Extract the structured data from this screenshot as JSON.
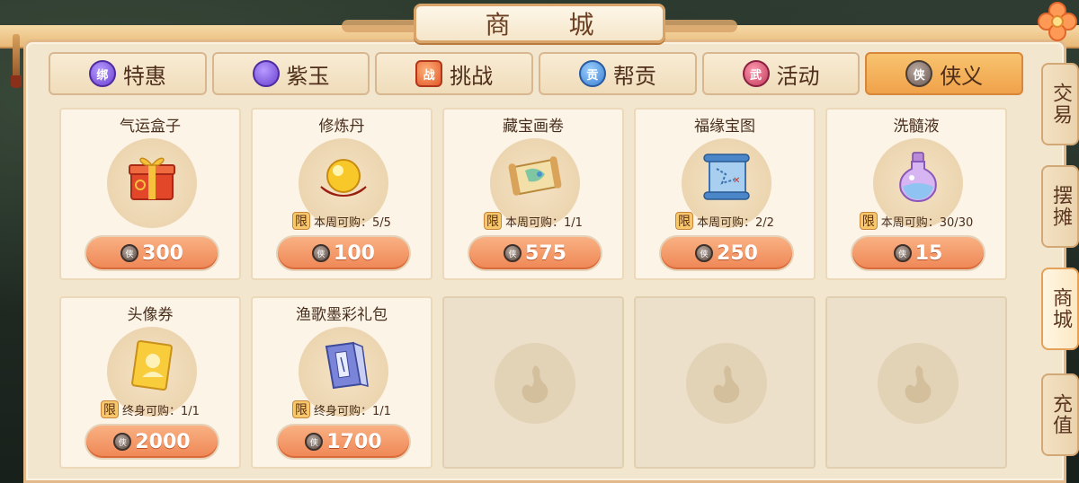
{
  "window": {
    "title": "商 城"
  },
  "tabs": [
    {
      "label": "特惠",
      "icon": "purple-orb-icon",
      "icon_text": "绑",
      "active": false
    },
    {
      "label": "紫玉",
      "icon": "purple-orb-icon",
      "icon_text": "",
      "active": false
    },
    {
      "label": "挑战",
      "icon": "challenge-badge-icon",
      "icon_text": "战",
      "active": false
    },
    {
      "label": "帮贡",
      "icon": "guild-shield-icon",
      "icon_text": "贡",
      "active": false
    },
    {
      "label": "活动",
      "icon": "event-badge-icon",
      "icon_text": "武",
      "active": false
    },
    {
      "label": "侠义",
      "icon": "chivalry-coin-icon",
      "icon_text": "侠",
      "active": true
    }
  ],
  "side_tabs": [
    {
      "label": "交易",
      "active": false
    },
    {
      "label": "摆摊",
      "active": false
    },
    {
      "label": "商城",
      "active": true
    },
    {
      "label": "充值",
      "active": false
    }
  ],
  "currency": {
    "icon": "chivalry-coin-icon",
    "glyph": "侠"
  },
  "items": [
    {
      "name": "气运盒子",
      "art": "gift-box",
      "limit_label": "",
      "limit_text": "",
      "price": "300"
    },
    {
      "name": "修炼丹",
      "art": "golden-pill",
      "limit_label": "限",
      "limit_text": "本周可购：5/5",
      "price": "100"
    },
    {
      "name": "藏宝画卷",
      "art": "treasure-scroll",
      "limit_label": "限",
      "limit_text": "本周可购：1/1",
      "price": "575"
    },
    {
      "name": "福缘宝图",
      "art": "blue-map",
      "limit_label": "限",
      "limit_text": "本周可购：2/2",
      "price": "250"
    },
    {
      "name": "洗髓液",
      "art": "potion-bottle",
      "limit_label": "限",
      "limit_text": "本周可购：30/30",
      "price": "15"
    },
    {
      "name": "头像券",
      "art": "avatar-ticket",
      "limit_label": "限",
      "limit_text": "终身可购：1/1",
      "price": "2000"
    },
    {
      "name": "渔歌墨彩礼包",
      "art": "book-pack",
      "limit_label": "限",
      "limit_text": "终身可购：1/1",
      "price": "1700"
    }
  ],
  "empty_slots": 3,
  "colors": {
    "accent": "#f0a24a",
    "price_button": "#ef8655",
    "panel": "#f3e6cf"
  }
}
